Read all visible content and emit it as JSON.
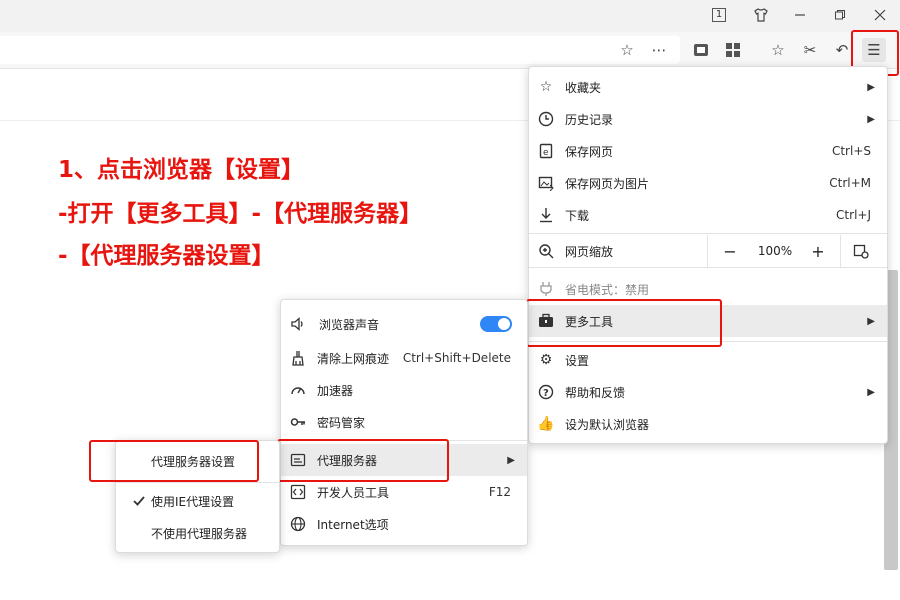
{
  "titlebar": {
    "badge": "1",
    "skin_icon": "tshirt-icon",
    "minimize_icon": "minimize-icon",
    "restore_icon": "restore-icon",
    "close_icon": "close-icon"
  },
  "toolbar": {
    "icons": [
      "star-icon",
      "more-icon",
      "reader-icon",
      "apps-icon",
      "favorites-icon",
      "scissors-icon",
      "undo-icon",
      "menu-icon"
    ]
  },
  "instructions": {
    "line1": "1、点击浏览器【设置】",
    "line2": "-打开【更多工具】-【代理服务器】",
    "line3": "-【代理服务器设置】"
  },
  "main_menu": {
    "favorites": "收藏夹",
    "history": "历史记录",
    "save_page": "保存网页",
    "save_page_sc": "Ctrl+S",
    "save_image": "保存网页为图片",
    "save_image_sc": "Ctrl+M",
    "download": "下载",
    "download_sc": "Ctrl+J",
    "zoom": "网页缩放",
    "zoom_minus": "−",
    "zoom_value": "100%",
    "zoom_plus": "+",
    "power_mode": "省电模式：禁用",
    "more_tools": "更多工具",
    "settings": "设置",
    "help": "帮助和反馈",
    "default_browser": "设为默认浏览器"
  },
  "tools_menu": {
    "sound": "浏览器声音",
    "sound_enabled": true,
    "clear": "清除上网痕迹",
    "clear_sc": "Ctrl+Shift+Delete",
    "accelerator": "加速器",
    "passwords": "密码管家",
    "proxy": "代理服务器",
    "devtools": "开发人员工具",
    "devtools_sc": "F12",
    "internet_options": "Internet选项"
  },
  "proxy_menu": {
    "proxy_settings": "代理服务器设置",
    "use_ie": "使用IE代理设置",
    "use_ie_checked": true,
    "no_proxy": "不使用代理服务器"
  },
  "colors": {
    "annotation_red": "#e8150f",
    "toggle_blue": "#2f86f6"
  }
}
